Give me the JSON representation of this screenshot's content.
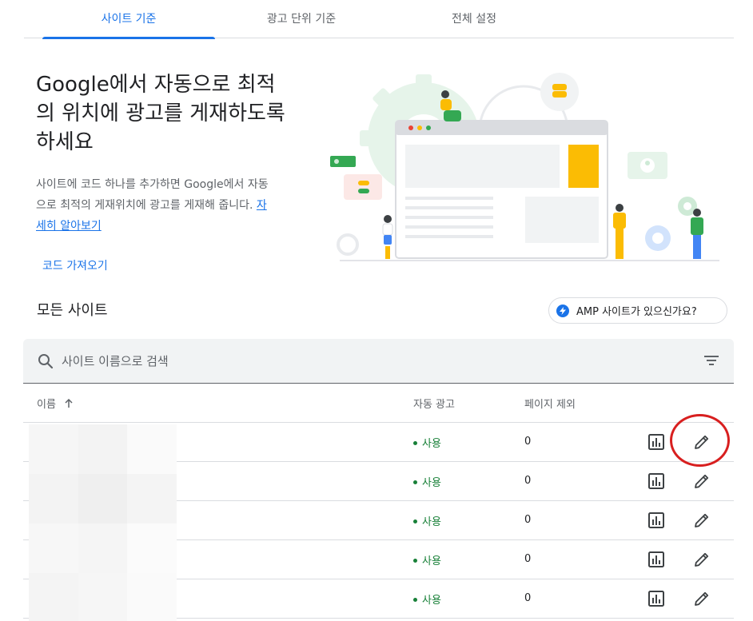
{
  "tabs": [
    {
      "label": "사이트 기준",
      "active": true
    },
    {
      "label": "광고 단위 기준",
      "active": false
    },
    {
      "label": "전체 설정",
      "active": false
    }
  ],
  "hero": {
    "title": "Google에서 자동으로 최적의 위치에 광고를 게재하도록 하세요",
    "description": "사이트에 코드 하나를 추가하면 Google에서 자동으로 최적의 게재위치에 광고를 게재해 줍니다.",
    "learn_more": "자세히 알아보기",
    "import_code": "코드 가져오기"
  },
  "sites": {
    "title": "모든 사이트",
    "amp_button": "AMP 사이트가 있으신가요?",
    "search_placeholder": "사이트 이름으로 검색"
  },
  "table": {
    "columns": {
      "name": "이름",
      "auto_ads": "자동 광고",
      "page_exclusions": "페이지 제외"
    },
    "rows": [
      {
        "status": "사용",
        "exclusions": "0"
      },
      {
        "status": "사용",
        "exclusions": "0"
      },
      {
        "status": "사용",
        "exclusions": "0"
      },
      {
        "status": "사용",
        "exclusions": "0"
      },
      {
        "status": "사용",
        "exclusions": "0"
      }
    ]
  },
  "colors": {
    "accent": "#1a73e8",
    "status_green": "#188038",
    "highlight_red": "#d81f1f"
  },
  "icons": [
    "search-icon",
    "filter-icon",
    "arrow-up-icon",
    "bolt-icon",
    "report-icon",
    "pencil-icon"
  ]
}
